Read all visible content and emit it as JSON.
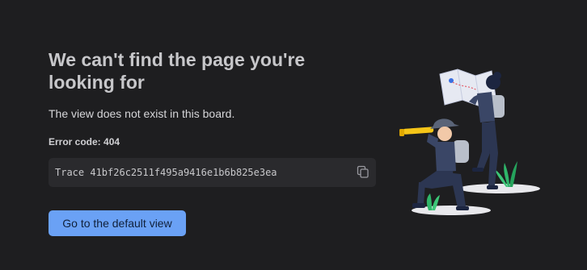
{
  "page": {
    "title": "We can't find the page you're looking for",
    "subtitle": "The view does not exist in this board.",
    "error_code_label": "Error code: 404",
    "trace_text": "Trace 41bf26c2511f495a9416e1b6b825e3ea",
    "primary_button": "Go to the default view"
  },
  "icons": {
    "copy": "copy-icon",
    "illustration": "explorers-illustration"
  },
  "colors": {
    "background": "#1e1e20",
    "trace_background": "#2a2a2d",
    "button": "#6aa1f5",
    "accent_yellow": "#f5c518"
  }
}
